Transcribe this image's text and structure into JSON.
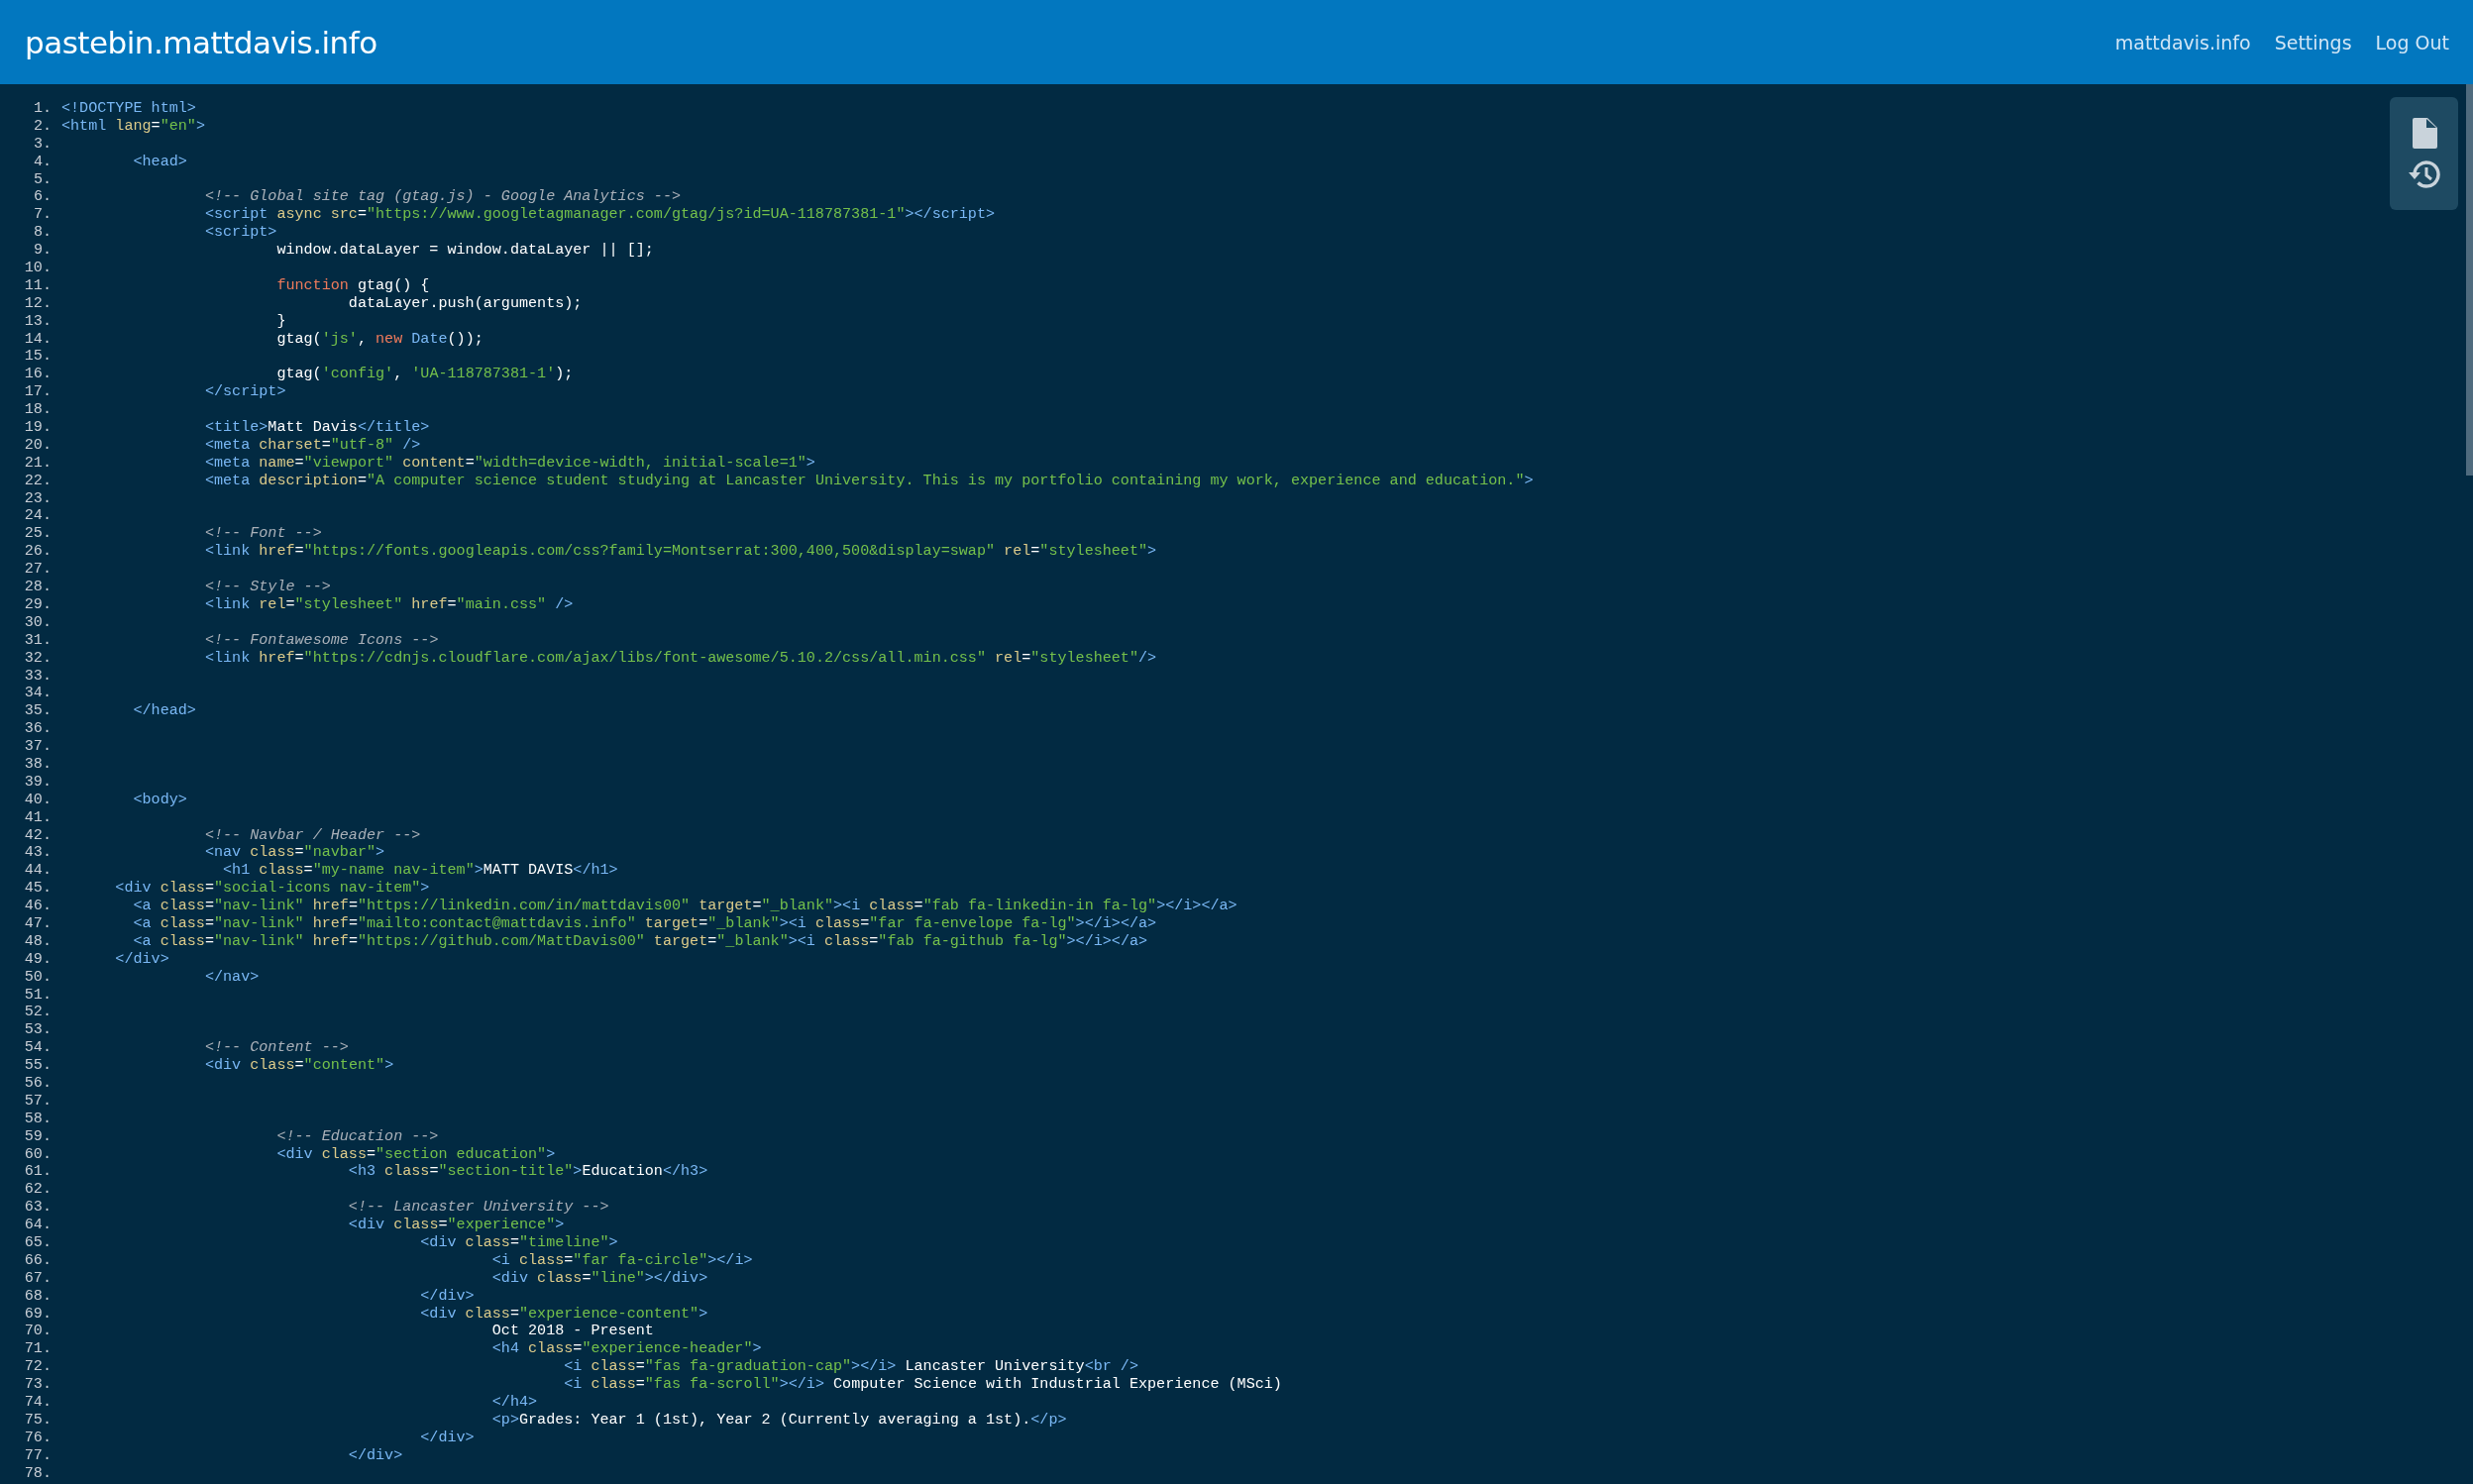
{
  "header": {
    "title": "pastebin.mattdavis.info",
    "links": [
      "mattdavis.info",
      "Settings",
      "Log Out"
    ]
  },
  "toolbar": {
    "buttons": [
      {
        "kind": "file"
      },
      {
        "kind": "history"
      }
    ]
  },
  "code": {
    "lines": [
      {
        "no": "1.",
        "tokens": [
          {
            "kind": "tag",
            "text": "<!DOCTYPE html>"
          }
        ]
      },
      {
        "no": "2.",
        "tokens": [
          {
            "kind": "tag",
            "text": "<html"
          },
          {
            "kind": "attr",
            "text": " lang"
          },
          {
            "kind": "text",
            "text": "="
          },
          {
            "kind": "str",
            "text": "\"en\""
          },
          {
            "kind": "tag",
            "text": ">"
          }
        ]
      },
      {
        "no": "3."
      },
      {
        "no": "4.",
        "tokens": [
          {
            "kind": "tag",
            "text": "\t<head>"
          }
        ]
      },
      {
        "no": "5."
      },
      {
        "no": "6.",
        "tokens": [
          {
            "kind": "comment",
            "text": "\t\t<!-- Global site tag (gtag.js) - Google Analytics -->"
          }
        ]
      },
      {
        "no": "7.",
        "tokens": [
          {
            "kind": "tag",
            "text": "\t\t<script"
          },
          {
            "kind": "attr",
            "text": " async src"
          },
          {
            "kind": "text",
            "text": "="
          },
          {
            "kind": "str",
            "text": "\"https://www.googletagmanager.com/gtag/js?id=UA-118787381-1\""
          },
          {
            "kind": "tag",
            "text": "></script>"
          }
        ]
      },
      {
        "no": "8.",
        "tokens": [
          {
            "kind": "tag",
            "text": "\t\t<script>"
          }
        ]
      },
      {
        "no": "9.",
        "tokens": [
          {
            "kind": "text",
            "text": "\t\t\twindow.dataLayer = window.dataLayer || [];"
          }
        ]
      },
      {
        "no": "10."
      },
      {
        "no": "11.",
        "tokens": [
          {
            "kind": "kw",
            "text": "\t\t\tfunction"
          },
          {
            "kind": "text",
            "text": " gtag() {"
          }
        ]
      },
      {
        "no": "12.",
        "tokens": [
          {
            "kind": "text",
            "text": "\t\t\t\tdataLayer.push(arguments);"
          }
        ]
      },
      {
        "no": "13.",
        "tokens": [
          {
            "kind": "text",
            "text": "\t\t\t}"
          }
        ]
      },
      {
        "no": "14.",
        "tokens": [
          {
            "kind": "text",
            "text": "\t\t\tgtag("
          },
          {
            "kind": "str",
            "text": "'js'"
          },
          {
            "kind": "text",
            "text": ", "
          },
          {
            "kind": "kw",
            "text": "new "
          },
          {
            "kind": "fn",
            "text": "Date"
          },
          {
            "kind": "text",
            "text": "());"
          }
        ]
      },
      {
        "no": "15."
      },
      {
        "no": "16.",
        "tokens": [
          {
            "kind": "text",
            "text": "\t\t\tgtag("
          },
          {
            "kind": "str",
            "text": "'config'"
          },
          {
            "kind": "text",
            "text": ", "
          },
          {
            "kind": "str",
            "text": "'UA-118787381-1'"
          },
          {
            "kind": "text",
            "text": ");"
          }
        ]
      },
      {
        "no": "17.",
        "tokens": [
          {
            "kind": "tag",
            "text": "\t\t</script>"
          }
        ]
      },
      {
        "no": "18."
      },
      {
        "no": "19.",
        "tokens": [
          {
            "kind": "tag",
            "text": "\t\t<title>"
          },
          {
            "kind": "text",
            "text": "Matt Davis"
          },
          {
            "kind": "tag",
            "text": "</title>"
          }
        ]
      },
      {
        "no": "20.",
        "tokens": [
          {
            "kind": "tag",
            "text": "\t\t<meta"
          },
          {
            "kind": "attr",
            "text": " charset"
          },
          {
            "kind": "text",
            "text": "="
          },
          {
            "kind": "str",
            "text": "\"utf-8\""
          },
          {
            "kind": "tag",
            "text": " />"
          }
        ]
      },
      {
        "no": "21.",
        "tokens": [
          {
            "kind": "tag",
            "text": "\t\t<meta"
          },
          {
            "kind": "attr",
            "text": " name"
          },
          {
            "kind": "text",
            "text": "="
          },
          {
            "kind": "str",
            "text": "\"viewport\""
          },
          {
            "kind": "attr",
            "text": " content"
          },
          {
            "kind": "text",
            "text": "="
          },
          {
            "kind": "str",
            "text": "\"width=device-width, initial-scale=1\""
          },
          {
            "kind": "tag",
            "text": ">"
          }
        ]
      },
      {
        "no": "22.",
        "tokens": [
          {
            "kind": "tag",
            "text": "\t\t<meta"
          },
          {
            "kind": "attr",
            "text": " description"
          },
          {
            "kind": "text",
            "text": "="
          },
          {
            "kind": "str",
            "text": "\"A computer science student studying at Lancaster University. This is my portfolio containing my work, experience and education.\""
          },
          {
            "kind": "tag",
            "text": ">"
          }
        ]
      },
      {
        "no": "23."
      },
      {
        "no": "24."
      },
      {
        "no": "25.",
        "tokens": [
          {
            "kind": "comment",
            "text": "\t\t<!-- Font -->"
          }
        ]
      },
      {
        "no": "26.",
        "tokens": [
          {
            "kind": "tag",
            "text": "\t\t<link"
          },
          {
            "kind": "attr",
            "text": " href"
          },
          {
            "kind": "text",
            "text": "="
          },
          {
            "kind": "str",
            "text": "\"https://fonts.googleapis.com/css?family=Montserrat:300,400,500&display=swap\""
          },
          {
            "kind": "attr",
            "text": " rel"
          },
          {
            "kind": "text",
            "text": "="
          },
          {
            "kind": "str",
            "text": "\"stylesheet\""
          },
          {
            "kind": "tag",
            "text": ">"
          }
        ]
      },
      {
        "no": "27."
      },
      {
        "no": "28.",
        "tokens": [
          {
            "kind": "comment",
            "text": "\t\t<!-- Style -->"
          }
        ]
      },
      {
        "no": "29.",
        "tokens": [
          {
            "kind": "tag",
            "text": "\t\t<link"
          },
          {
            "kind": "attr",
            "text": " rel"
          },
          {
            "kind": "text",
            "text": "="
          },
          {
            "kind": "str",
            "text": "\"stylesheet\""
          },
          {
            "kind": "attr",
            "text": " href"
          },
          {
            "kind": "text",
            "text": "="
          },
          {
            "kind": "str",
            "text": "\"main.css\""
          },
          {
            "kind": "tag",
            "text": " />"
          }
        ]
      },
      {
        "no": "30."
      },
      {
        "no": "31.",
        "tokens": [
          {
            "kind": "comment",
            "text": "\t\t<!-- Fontawesome Icons -->"
          }
        ]
      },
      {
        "no": "32.",
        "tokens": [
          {
            "kind": "tag",
            "text": "\t\t<link"
          },
          {
            "kind": "attr",
            "text": " href"
          },
          {
            "kind": "text",
            "text": "="
          },
          {
            "kind": "str",
            "text": "\"https://cdnjs.cloudflare.com/ajax/libs/font-awesome/5.10.2/css/all.min.css\""
          },
          {
            "kind": "attr",
            "text": " rel"
          },
          {
            "kind": "text",
            "text": "="
          },
          {
            "kind": "str",
            "text": "\"stylesheet\""
          },
          {
            "kind": "tag",
            "text": "/>"
          }
        ]
      },
      {
        "no": "33."
      },
      {
        "no": "34."
      },
      {
        "no": "35.",
        "tokens": [
          {
            "kind": "tag",
            "text": "\t</head>"
          }
        ]
      },
      {
        "no": "36."
      },
      {
        "no": "37."
      },
      {
        "no": "38."
      },
      {
        "no": "39."
      },
      {
        "no": "40.",
        "tokens": [
          {
            "kind": "tag",
            "text": "\t<body>"
          }
        ]
      },
      {
        "no": "41."
      },
      {
        "no": "42.",
        "tokens": [
          {
            "kind": "comment",
            "text": "\t\t<!-- Navbar / Header -->"
          }
        ]
      },
      {
        "no": "43.",
        "tokens": [
          {
            "kind": "tag",
            "text": "\t\t<nav"
          },
          {
            "kind": "attr",
            "text": " class"
          },
          {
            "kind": "text",
            "text": "="
          },
          {
            "kind": "str",
            "text": "\"navbar\""
          },
          {
            "kind": "tag",
            "text": ">"
          }
        ]
      },
      {
        "no": "44.",
        "tokens": [
          {
            "kind": "tag",
            "text": "\t\t  <h1"
          },
          {
            "kind": "attr",
            "text": " class"
          },
          {
            "kind": "text",
            "text": "="
          },
          {
            "kind": "str",
            "text": "\"my-name nav-item\""
          },
          {
            "kind": "tag",
            "text": ">"
          },
          {
            "kind": "text",
            "text": "MATT DAVIS"
          },
          {
            "kind": "tag",
            "text": "</h1>"
          }
        ]
      },
      {
        "no": "45.",
        "tokens": [
          {
            "kind": "tag",
            "text": "      <div"
          },
          {
            "kind": "attr",
            "text": " class"
          },
          {
            "kind": "text",
            "text": "="
          },
          {
            "kind": "str",
            "text": "\"social-icons nav-item\""
          },
          {
            "kind": "tag",
            "text": ">"
          }
        ]
      },
      {
        "no": "46.",
        "tokens": [
          {
            "kind": "tag",
            "text": "        <a"
          },
          {
            "kind": "attr",
            "text": " class"
          },
          {
            "kind": "text",
            "text": "="
          },
          {
            "kind": "str",
            "text": "\"nav-link\""
          },
          {
            "kind": "attr",
            "text": " href"
          },
          {
            "kind": "text",
            "text": "="
          },
          {
            "kind": "str",
            "text": "\"https://linkedin.com/in/mattdavis00\""
          },
          {
            "kind": "attr",
            "text": " target"
          },
          {
            "kind": "text",
            "text": "="
          },
          {
            "kind": "str",
            "text": "\"_blank\""
          },
          {
            "kind": "tag",
            "text": "><i"
          },
          {
            "kind": "attr",
            "text": " class"
          },
          {
            "kind": "text",
            "text": "="
          },
          {
            "kind": "str",
            "text": "\"fab fa-linkedin-in fa-lg\""
          },
          {
            "kind": "tag",
            "text": "></i></a>"
          }
        ]
      },
      {
        "no": "47.",
        "tokens": [
          {
            "kind": "tag",
            "text": "        <a"
          },
          {
            "kind": "attr",
            "text": " class"
          },
          {
            "kind": "text",
            "text": "="
          },
          {
            "kind": "str",
            "text": "\"nav-link\""
          },
          {
            "kind": "attr",
            "text": " href"
          },
          {
            "kind": "text",
            "text": "="
          },
          {
            "kind": "str",
            "text": "\"mailto:contact@mattdavis.info\""
          },
          {
            "kind": "attr",
            "text": " target"
          },
          {
            "kind": "text",
            "text": "="
          },
          {
            "kind": "str",
            "text": "\"_blank\""
          },
          {
            "kind": "tag",
            "text": "><i"
          },
          {
            "kind": "attr",
            "text": " class"
          },
          {
            "kind": "text",
            "text": "="
          },
          {
            "kind": "str",
            "text": "\"far fa-envelope fa-lg\""
          },
          {
            "kind": "tag",
            "text": "></i></a>"
          }
        ]
      },
      {
        "no": "48.",
        "tokens": [
          {
            "kind": "tag",
            "text": "        <a"
          },
          {
            "kind": "attr",
            "text": " class"
          },
          {
            "kind": "text",
            "text": "="
          },
          {
            "kind": "str",
            "text": "\"nav-link\""
          },
          {
            "kind": "attr",
            "text": " href"
          },
          {
            "kind": "text",
            "text": "="
          },
          {
            "kind": "str",
            "text": "\"https://github.com/MattDavis00\""
          },
          {
            "kind": "attr",
            "text": " target"
          },
          {
            "kind": "text",
            "text": "="
          },
          {
            "kind": "str",
            "text": "\"_blank\""
          },
          {
            "kind": "tag",
            "text": "><i"
          },
          {
            "kind": "attr",
            "text": " class"
          },
          {
            "kind": "text",
            "text": "="
          },
          {
            "kind": "str",
            "text": "\"fab fa-github fa-lg\""
          },
          {
            "kind": "tag",
            "text": "></i></a>"
          }
        ]
      },
      {
        "no": "49.",
        "tokens": [
          {
            "kind": "tag",
            "text": "      </div>"
          }
        ]
      },
      {
        "no": "50.",
        "tokens": [
          {
            "kind": "tag",
            "text": "\t\t</nav>"
          }
        ]
      },
      {
        "no": "51."
      },
      {
        "no": "52."
      },
      {
        "no": "53."
      },
      {
        "no": "54.",
        "tokens": [
          {
            "kind": "comment",
            "text": "\t\t<!-- Content -->"
          }
        ]
      },
      {
        "no": "55.",
        "tokens": [
          {
            "kind": "tag",
            "text": "\t\t<div"
          },
          {
            "kind": "attr",
            "text": " class"
          },
          {
            "kind": "text",
            "text": "="
          },
          {
            "kind": "str",
            "text": "\"content\""
          },
          {
            "kind": "tag",
            "text": ">"
          }
        ]
      },
      {
        "no": "56."
      },
      {
        "no": "57."
      },
      {
        "no": "58."
      },
      {
        "no": "59.",
        "tokens": [
          {
            "kind": "comment",
            "text": "\t\t\t<!-- Education -->"
          }
        ]
      },
      {
        "no": "60.",
        "tokens": [
          {
            "kind": "tag",
            "text": "\t\t\t<div"
          },
          {
            "kind": "attr",
            "text": " class"
          },
          {
            "kind": "text",
            "text": "="
          },
          {
            "kind": "str",
            "text": "\"section education\""
          },
          {
            "kind": "tag",
            "text": ">"
          }
        ]
      },
      {
        "no": "61.",
        "tokens": [
          {
            "kind": "tag",
            "text": "\t\t\t\t<h3"
          },
          {
            "kind": "attr",
            "text": " class"
          },
          {
            "kind": "text",
            "text": "="
          },
          {
            "kind": "str",
            "text": "\"section-title\""
          },
          {
            "kind": "tag",
            "text": ">"
          },
          {
            "kind": "text",
            "text": "Education"
          },
          {
            "kind": "tag",
            "text": "</h3>"
          }
        ]
      },
      {
        "no": "62."
      },
      {
        "no": "63.",
        "tokens": [
          {
            "kind": "comment",
            "text": "\t\t\t\t<!-- Lancaster University -->"
          }
        ]
      },
      {
        "no": "64.",
        "tokens": [
          {
            "kind": "tag",
            "text": "\t\t\t\t<div"
          },
          {
            "kind": "attr",
            "text": " class"
          },
          {
            "kind": "text",
            "text": "="
          },
          {
            "kind": "str",
            "text": "\"experience\""
          },
          {
            "kind": "tag",
            "text": ">"
          }
        ]
      },
      {
        "no": "65.",
        "tokens": [
          {
            "kind": "tag",
            "text": "\t\t\t\t\t<div"
          },
          {
            "kind": "attr",
            "text": " class"
          },
          {
            "kind": "text",
            "text": "="
          },
          {
            "kind": "str",
            "text": "\"timeline\""
          },
          {
            "kind": "tag",
            "text": ">"
          }
        ]
      },
      {
        "no": "66.",
        "tokens": [
          {
            "kind": "tag",
            "text": "\t\t\t\t\t\t<i"
          },
          {
            "kind": "attr",
            "text": " class"
          },
          {
            "kind": "text",
            "text": "="
          },
          {
            "kind": "str",
            "text": "\"far fa-circle\""
          },
          {
            "kind": "tag",
            "text": "></i>"
          }
        ]
      },
      {
        "no": "67.",
        "tokens": [
          {
            "kind": "tag",
            "text": "\t\t\t\t\t\t<div"
          },
          {
            "kind": "attr",
            "text": " class"
          },
          {
            "kind": "text",
            "text": "="
          },
          {
            "kind": "str",
            "text": "\"line\""
          },
          {
            "kind": "tag",
            "text": "></div>"
          }
        ]
      },
      {
        "no": "68.",
        "tokens": [
          {
            "kind": "tag",
            "text": "\t\t\t\t\t</div>"
          }
        ]
      },
      {
        "no": "69.",
        "tokens": [
          {
            "kind": "tag",
            "text": "\t\t\t\t\t<div"
          },
          {
            "kind": "attr",
            "text": " class"
          },
          {
            "kind": "text",
            "text": "="
          },
          {
            "kind": "str",
            "text": "\"experience-content\""
          },
          {
            "kind": "tag",
            "text": ">"
          }
        ]
      },
      {
        "no": "70.",
        "tokens": [
          {
            "kind": "text",
            "text": "\t\t\t\t\t\tOct 2018 - Present"
          }
        ]
      },
      {
        "no": "71.",
        "tokens": [
          {
            "kind": "tag",
            "text": "\t\t\t\t\t\t<h4"
          },
          {
            "kind": "attr",
            "text": " class"
          },
          {
            "kind": "text",
            "text": "="
          },
          {
            "kind": "str",
            "text": "\"experience-header\""
          },
          {
            "kind": "tag",
            "text": ">"
          }
        ]
      },
      {
        "no": "72.",
        "tokens": [
          {
            "kind": "tag",
            "text": "\t\t\t\t\t\t\t<i"
          },
          {
            "kind": "attr",
            "text": " class"
          },
          {
            "kind": "text",
            "text": "="
          },
          {
            "kind": "str",
            "text": "\"fas fa-graduation-cap\""
          },
          {
            "kind": "tag",
            "text": "></i>"
          },
          {
            "kind": "text",
            "text": " Lancaster University"
          },
          {
            "kind": "tag",
            "text": "<br />"
          }
        ]
      },
      {
        "no": "73.",
        "tokens": [
          {
            "kind": "tag",
            "text": "\t\t\t\t\t\t\t<i"
          },
          {
            "kind": "attr",
            "text": " class"
          },
          {
            "kind": "text",
            "text": "="
          },
          {
            "kind": "str",
            "text": "\"fas fa-scroll\""
          },
          {
            "kind": "tag",
            "text": "></i>"
          },
          {
            "kind": "text",
            "text": " Computer Science with Industrial Experience (MSci)"
          }
        ]
      },
      {
        "no": "74.",
        "tokens": [
          {
            "kind": "tag",
            "text": "\t\t\t\t\t\t</h4>"
          }
        ]
      },
      {
        "no": "75.",
        "tokens": [
          {
            "kind": "tag",
            "text": "\t\t\t\t\t\t<p>"
          },
          {
            "kind": "text",
            "text": "Grades: Year 1 (1st), Year 2 (Currently averaging a 1st)."
          },
          {
            "kind": "tag",
            "text": "</p>"
          }
        ]
      },
      {
        "no": "76.",
        "tokens": [
          {
            "kind": "tag",
            "text": "\t\t\t\t\t</div>"
          }
        ]
      },
      {
        "no": "77.",
        "tokens": [
          {
            "kind": "tag",
            "text": "\t\t\t\t</div>"
          }
        ]
      },
      {
        "no": "78."
      }
    ]
  }
}
